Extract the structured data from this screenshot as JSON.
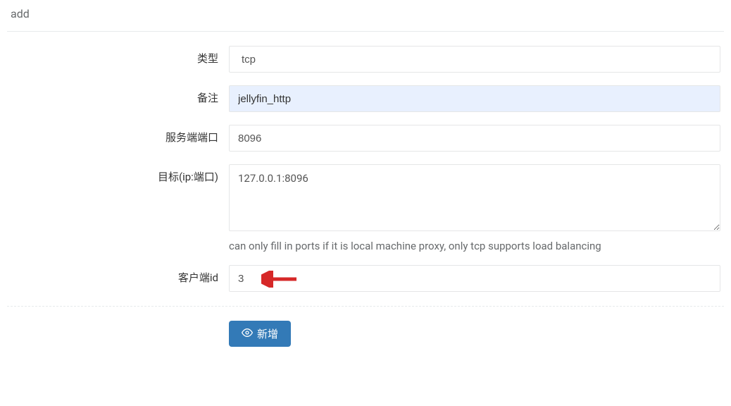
{
  "pageTitle": "add",
  "form": {
    "type": {
      "label": "类型",
      "value": "tcp"
    },
    "remark": {
      "label": "备注",
      "value": "jellyfin_http"
    },
    "serverPort": {
      "label": "服务端端口",
      "value": "8096"
    },
    "target": {
      "label": "目标(ip:端口)",
      "value": "127.0.0.1:8096",
      "help": "can only fill in ports if it is local machine proxy, only tcp supports load balancing"
    },
    "clientId": {
      "label": "客户端id",
      "value": "3"
    }
  },
  "submitButton": {
    "label": "新增"
  }
}
